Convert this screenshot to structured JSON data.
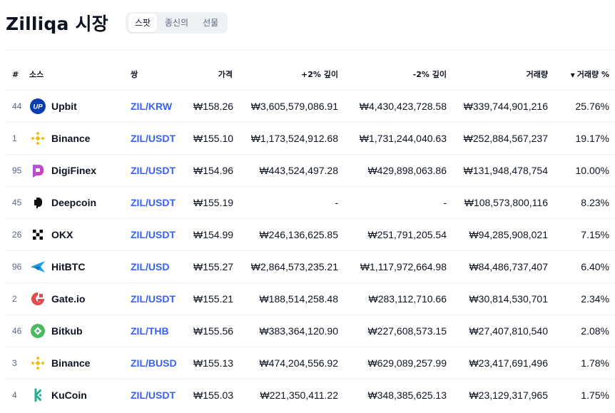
{
  "header": {
    "title": "Zilliqa 시장",
    "tabs": [
      "스팟",
      "종신의",
      "선물"
    ],
    "active_tab": 0
  },
  "table": {
    "columns": {
      "rank": "#",
      "source": "소스",
      "pair": "쌍",
      "price": "가격",
      "depth_plus": "+2% 깊이",
      "depth_minus": "-2% 깊이",
      "volume": "거래량",
      "volume_pct": "거래량 %"
    },
    "sort": {
      "column": "volume_pct",
      "direction": "desc"
    },
    "rows": [
      {
        "rank": "44",
        "exchange": "Upbit",
        "logo": "upbit-logo",
        "pair": "ZIL/KRW",
        "price": "₩158.26",
        "depth_plus": "₩3,605,579,086.91",
        "depth_minus": "₩4,430,423,728.58",
        "volume": "₩339,744,901,216",
        "volume_pct": "25.76%"
      },
      {
        "rank": "1",
        "exchange": "Binance",
        "logo": "binance-logo",
        "pair": "ZIL/USDT",
        "price": "₩155.10",
        "depth_plus": "₩1,173,524,912.68",
        "depth_minus": "₩1,731,244,040.63",
        "volume": "₩252,884,567,237",
        "volume_pct": "19.17%"
      },
      {
        "rank": "95",
        "exchange": "DigiFinex",
        "logo": "digifinex-logo",
        "pair": "ZIL/USDT",
        "price": "₩154.96",
        "depth_plus": "₩443,524,497.28",
        "depth_minus": "₩429,898,063.86",
        "volume": "₩131,948,478,754",
        "volume_pct": "10.00%"
      },
      {
        "rank": "45",
        "exchange": "Deepcoin",
        "logo": "deepcoin-logo",
        "pair": "ZIL/USDT",
        "price": "₩155.19",
        "depth_plus": "-",
        "depth_minus": "-",
        "volume": "₩108,573,800,116",
        "volume_pct": "8.23%"
      },
      {
        "rank": "26",
        "exchange": "OKX",
        "logo": "okx-logo",
        "pair": "ZIL/USDT",
        "price": "₩154.99",
        "depth_plus": "₩246,136,625.85",
        "depth_minus": "₩251,791,205.54",
        "volume": "₩94,285,908,021",
        "volume_pct": "7.15%"
      },
      {
        "rank": "96",
        "exchange": "HitBTC",
        "logo": "hitbtc-logo",
        "pair": "ZIL/USD",
        "price": "₩155.27",
        "depth_plus": "₩2,864,573,235.21",
        "depth_minus": "₩1,117,972,664.98",
        "volume": "₩84,486,737,407",
        "volume_pct": "6.40%"
      },
      {
        "rank": "2",
        "exchange": "Gate.io",
        "logo": "gateio-logo",
        "pair": "ZIL/USDT",
        "price": "₩155.21",
        "depth_plus": "₩188,514,258.48",
        "depth_minus": "₩283,112,710.66",
        "volume": "₩30,814,530,701",
        "volume_pct": "2.34%"
      },
      {
        "rank": "46",
        "exchange": "Bitkub",
        "logo": "bitkub-logo",
        "pair": "ZIL/THB",
        "price": "₩155.56",
        "depth_plus": "₩383,364,120.90",
        "depth_minus": "₩227,608,573.15",
        "volume": "₩27,407,810,540",
        "volume_pct": "2.08%"
      },
      {
        "rank": "3",
        "exchange": "Binance",
        "logo": "binance-logo",
        "pair": "ZIL/BUSD",
        "price": "₩155.13",
        "depth_plus": "₩474,204,556.92",
        "depth_minus": "₩629,089,257.99",
        "volume": "₩23,417,691,496",
        "volume_pct": "1.78%"
      },
      {
        "rank": "4",
        "exchange": "KuCoin",
        "logo": "kucoin-logo",
        "pair": "ZIL/USDT",
        "price": "₩155.03",
        "depth_plus": "₩221,350,411.22",
        "depth_minus": "₩348,385,625.13",
        "volume": "₩23,129,317,965",
        "volume_pct": "1.75%"
      }
    ]
  }
}
